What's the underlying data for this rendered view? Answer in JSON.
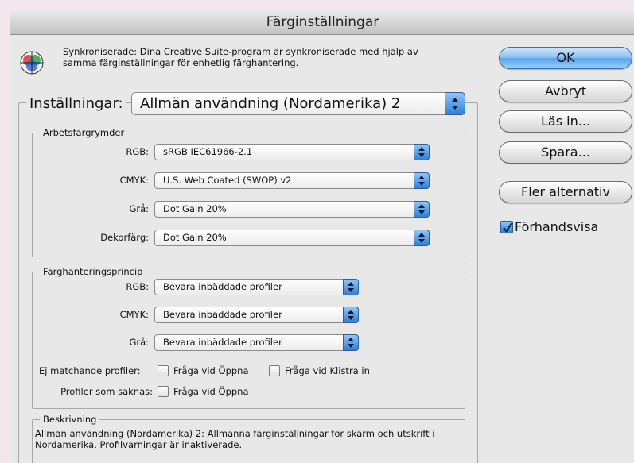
{
  "window": {
    "title": "Färginställningar"
  },
  "sync": {
    "text": "Synkroniserade: Dina Creative Suite-program är synkroniserade med hjälp av samma färginställningar för enhetlig färghantering."
  },
  "buttons": {
    "ok": "OK",
    "cancel": "Avbryt",
    "load": "Läs in...",
    "save": "Spara...",
    "more": "Fler alternativ"
  },
  "preview": {
    "label": "Förhandsvisa",
    "checked": true
  },
  "settings": {
    "label": "Inställningar:",
    "value": "Allmän användning (Nordamerika) 2"
  },
  "working_spaces": {
    "legend": "Arbetsfärgrymder",
    "rows": [
      {
        "label": "RGB:",
        "value": "sRGB IEC61966-2.1"
      },
      {
        "label": "CMYK:",
        "value": "U.S. Web Coated (SWOP) v2"
      },
      {
        "label": "Grå:",
        "value": "Dot Gain 20%"
      },
      {
        "label": "Dekorfärg:",
        "value": "Dot Gain 20%"
      }
    ]
  },
  "policies": {
    "legend": "Färghanteringsprincip",
    "rows": [
      {
        "label": "RGB:",
        "value": "Bevara inbäddade profiler"
      },
      {
        "label": "CMYK:",
        "value": "Bevara inbäddade profiler"
      },
      {
        "label": "Grå:",
        "value": "Bevara inbäddade profiler"
      }
    ],
    "mismatch_label": "Ej matchande profiler:",
    "mismatch_open": "Fråga vid Öppna",
    "mismatch_paste": "Fråga vid Klistra in",
    "missing_label": "Profiler som saknas:",
    "missing_open": "Fråga vid Öppna"
  },
  "description": {
    "legend": "Beskrivning",
    "text": "Allmän användning (Nordamerika) 2:  Allmänna färginställningar för skärm och utskrift i Nordamerika. Profilvarningar är inaktiverade."
  },
  "colors": {
    "accent": "#2f7fdc",
    "default_button": "#8ec4f2",
    "background": "#f4e6ee",
    "dialog": "#e8e8e8"
  }
}
